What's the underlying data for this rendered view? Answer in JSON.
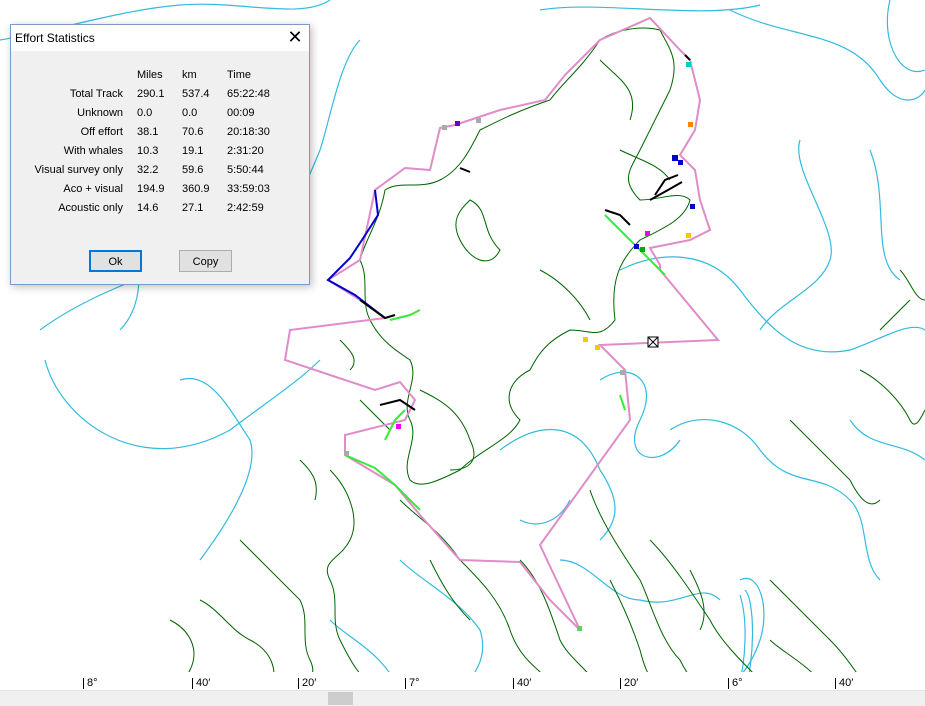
{
  "dialog": {
    "title": "Effort Statistics",
    "close_glyph": "✕",
    "columns": [
      "Miles",
      "km",
      "Time"
    ],
    "rows": [
      {
        "label": "Total Track",
        "miles": "290.1",
        "km": "537.4",
        "time": "65:22:48"
      },
      {
        "label": "Unknown",
        "miles": "0.0",
        "km": "0.0",
        "time": "00:09"
      },
      {
        "label": "Off effort",
        "miles": "38.1",
        "km": "70.6",
        "time": "20:18:30"
      },
      {
        "label": "With whales",
        "miles": "10.3",
        "km": "19.1",
        "time": "2:31:20"
      },
      {
        "label": "Visual survey only",
        "miles": "32.2",
        "km": "59.6",
        "time": "5:50:44"
      },
      {
        "label": "Aco + visual",
        "miles": "194.9",
        "km": "360.9",
        "time": "33:59:03"
      },
      {
        "label": "Acoustic only",
        "miles": "14.6",
        "km": "27.1",
        "time": "2:42:59"
      }
    ],
    "ok_label": "Ok",
    "copy_label": "Copy"
  },
  "scale_ticks": [
    "8°",
    "40′",
    "20′",
    "7°",
    "40′",
    "20′",
    "6°",
    "40′"
  ],
  "colors": {
    "coastline": "#006400",
    "depth_contour": "#33bbdd",
    "track_offeffort": "#e08cc8",
    "track_visual": "#0000cc",
    "track_aco_visual": "#33ee33",
    "track_acoustic": "#000000",
    "dialog_bg": "#f0f0f0"
  },
  "icons": {
    "close": "close-icon",
    "marker": "vessel-marker-icon"
  }
}
